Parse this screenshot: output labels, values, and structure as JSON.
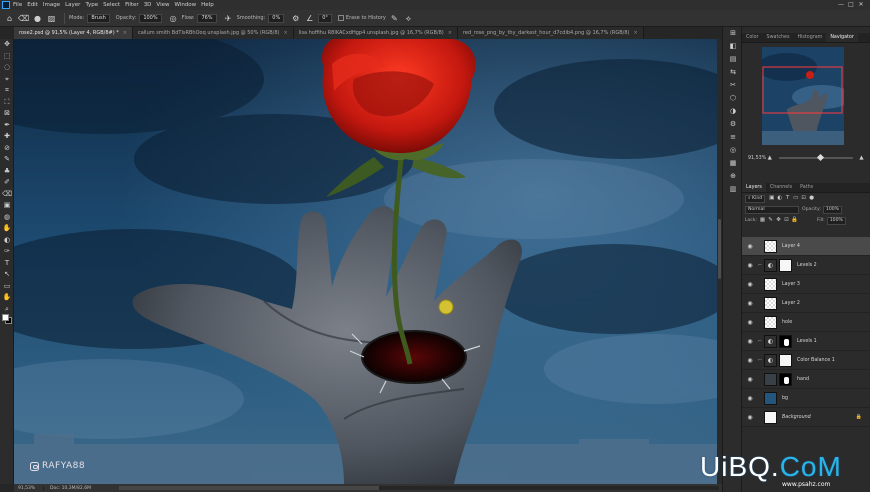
{
  "menu": {
    "items": [
      "File",
      "Edit",
      "Image",
      "Layer",
      "Type",
      "Select",
      "Filter",
      "3D",
      "View",
      "Window",
      "Help"
    ],
    "window_controls": [
      "—",
      "□",
      "✕"
    ]
  },
  "options": {
    "mode_label": "Mode:",
    "mode_value": "Brush",
    "opacity_label": "Opacity:",
    "opacity_value": "100%",
    "flow_label": "Flow:",
    "flow_value": "76%",
    "smoothing_label": "Smoothing:",
    "smoothing_value": "0%",
    "angle_value": "0°",
    "erase_history_label": "Erase to History"
  },
  "tabs": [
    {
      "label": "rose2.psd @ 91,5% (Layer 4, RGB/8#) *",
      "active": true
    },
    {
      "label": "callum smith BdTIsRBhOoq unsplash.jpg @ 50% (RGB/8)",
      "active": false
    },
    {
      "label": "lisa hoffihu R8IKACxdHgp4 unsplash.jpg @ 16,7% (RGB/8)",
      "active": false
    },
    {
      "label": "red_rose_png_by_thy_darkest_hour_d7cdib4.png @ 16,7% (RGB/8)",
      "active": false
    }
  ],
  "tools": [
    "✥",
    "⬚",
    "◌",
    "⌖",
    "⌗",
    "⛶",
    "⊠",
    "✒",
    "✚",
    "⊘",
    "✎",
    "♣",
    "✐",
    "⌫",
    "▣",
    "◍",
    "✋",
    "◐",
    "✑",
    "T",
    "↖",
    "▭",
    "✋",
    "⌕",
    "⋯"
  ],
  "status": {
    "zoom": "91,53%",
    "doc": "Doc: 10,3M/82,6M"
  },
  "watermark": "RAFYA88",
  "right_strip_icons": [
    "⊞",
    "◧",
    "▤",
    "⇆",
    "✂",
    "⬡",
    "◑",
    "⚙",
    "≡",
    "◎",
    "▦",
    "⊕",
    "▥"
  ],
  "navigator": {
    "tabs": [
      {
        "label": "Color",
        "active": false
      },
      {
        "label": "Swatches",
        "active": false
      },
      {
        "label": "Histogram",
        "active": false
      },
      {
        "label": "Navigator",
        "active": true
      }
    ],
    "zoom": "91,53%",
    "zoom_fraction": 0.45
  },
  "layers_panel": {
    "tabs": [
      {
        "label": "Layers",
        "active": true
      },
      {
        "label": "Channels",
        "active": false
      },
      {
        "label": "Paths",
        "active": false
      }
    ],
    "kind_label": "Kind",
    "blend_mode": "Normal",
    "opacity_label": "Opacity:",
    "opacity_value": "100%",
    "lock_label": "Lock:",
    "fill_label": "Fill:",
    "fill_value": "100%",
    "layers": [
      {
        "name": "Layer 4",
        "thumb": "checker",
        "mask": "",
        "selected": true,
        "fx": "",
        "italic": false,
        "lock": false
      },
      {
        "name": "Levels 2",
        "thumb": "adj",
        "mask": "white",
        "selected": false,
        "fx": "⌐",
        "italic": false,
        "lock": false
      },
      {
        "name": "Layer 3",
        "thumb": "checker",
        "mask": "",
        "selected": false,
        "fx": "",
        "italic": false,
        "lock": false
      },
      {
        "name": "Layer 2",
        "thumb": "checker",
        "mask": "",
        "selected": false,
        "fx": "",
        "italic": false,
        "lock": false
      },
      {
        "name": "hole",
        "thumb": "checker",
        "mask": "",
        "selected": false,
        "fx": "",
        "italic": false,
        "lock": false
      },
      {
        "name": "Levels 1",
        "thumb": "adj",
        "mask": "mask",
        "selected": false,
        "fx": "⌐",
        "italic": false,
        "lock": false
      },
      {
        "name": "Color Balance 1",
        "thumb": "adj",
        "mask": "white",
        "selected": false,
        "fx": "⌐",
        "italic": false,
        "lock": false
      },
      {
        "name": "hand",
        "thumb": "photo",
        "mask": "mask",
        "selected": false,
        "fx": "",
        "italic": false,
        "lock": false
      },
      {
        "name": "bg",
        "thumb": "sky",
        "mask": "",
        "selected": false,
        "fx": "",
        "italic": false,
        "lock": false
      },
      {
        "name": "Background",
        "thumb": "white",
        "mask": "",
        "selected": false,
        "fx": "",
        "italic": true,
        "lock": true
      }
    ]
  },
  "brand": {
    "name_a": "UiBQ.",
    "name_b": "CoM",
    "site": "www.psahz.com"
  },
  "colors": {
    "accent": "#31a8ff",
    "rose": "#c81e14",
    "sky": "#1a4266",
    "brush_cursor": "#e8d22a"
  }
}
